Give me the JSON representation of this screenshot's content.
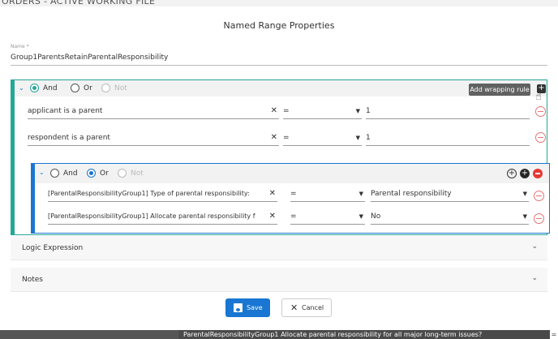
{
  "background": {
    "title": "ORDERS - ACTIVE WORKING FILE",
    "bottom_text": "ParentalResponsibilityGroup1   Allocate parental responsibility for all major long-term issues?",
    "bottom_eq": "="
  },
  "dialog": {
    "title": "Named Range Properties",
    "name_label": "Name *",
    "name_value": "Group1ParentsRetainParentalResponsibility"
  },
  "group1": {
    "and_label": "And",
    "or_label": "Or",
    "not_label": "Not",
    "selected": "And",
    "tooltip": "Add wrapping rule",
    "rules": [
      {
        "field": "applicant is a parent",
        "operator": "=",
        "value": "1"
      },
      {
        "field": "respondent is a parent",
        "operator": "=",
        "value": "1"
      }
    ]
  },
  "group2": {
    "and_label": "And",
    "or_label": "Or",
    "not_label": "Not",
    "selected": "Or",
    "rules": [
      {
        "field": "[ParentalResponsibilityGroup1] Type of parental responsibility:",
        "operator": "=",
        "value": "Parental responsibility"
      },
      {
        "field": "[ParentalResponsibilityGroup1] Allocate parental responsibility f",
        "operator": "=",
        "value": "No"
      }
    ]
  },
  "sections": {
    "logic_expression": "Logic Expression",
    "notes": "Notes"
  },
  "buttons": {
    "save": "Save",
    "cancel": "Cancel"
  },
  "colors": {
    "teal": "#26a69a",
    "blue": "#1976d2",
    "red": "#e53935"
  }
}
